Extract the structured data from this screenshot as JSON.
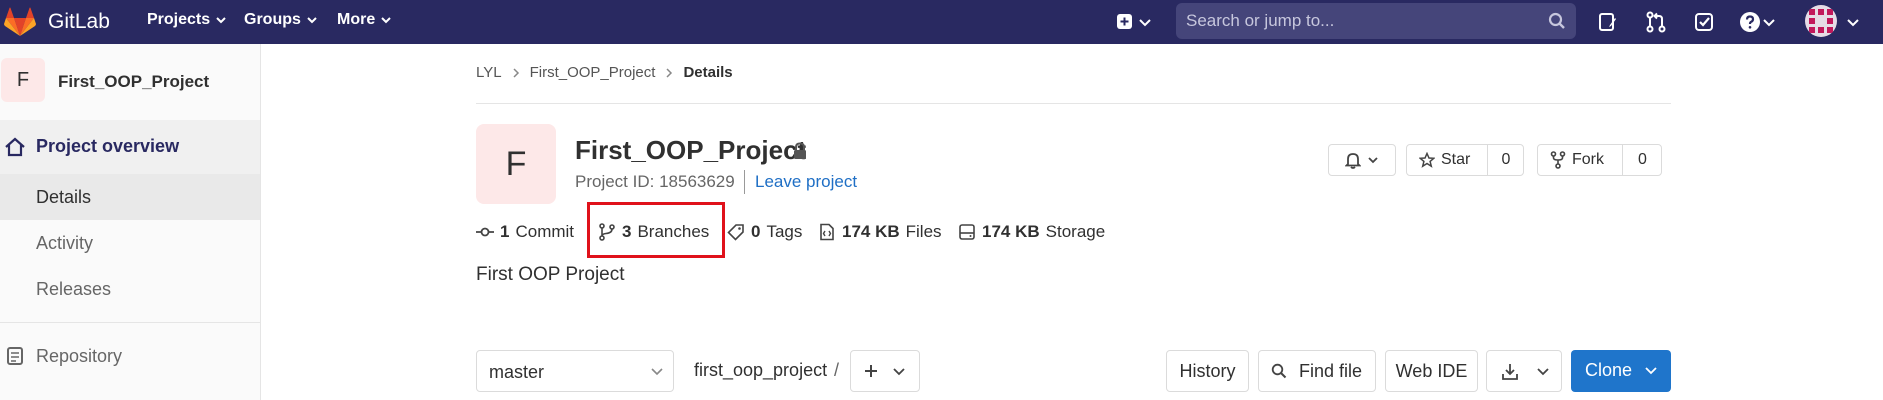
{
  "topbar": {
    "brand": "GitLab",
    "menus": [
      "Projects",
      "Groups",
      "More"
    ],
    "search_placeholder": "Search or jump to..."
  },
  "sidebar": {
    "project_initial": "F",
    "project_name": "First_OOP_Project",
    "overview_label": "Project overview",
    "items": [
      "Details",
      "Activity",
      "Releases"
    ],
    "repository_label": "Repository"
  },
  "breadcrumb": [
    "LYL",
    "First_OOP_Project",
    "Details"
  ],
  "project": {
    "initial": "F",
    "title": "First_OOP_Project",
    "id_text": "Project ID: 18563629",
    "leave_label": "Leave project",
    "star_label": "Star",
    "star_count": "0",
    "fork_label": "Fork",
    "fork_count": "0",
    "description": "First OOP Project"
  },
  "stats": {
    "commits_count": "1",
    "commits_label": "Commit",
    "branches_count": "3",
    "branches_label": "Branches",
    "tags_count": "0",
    "tags_label": "Tags",
    "files_size": "174 KB",
    "files_label": "Files",
    "storage_size": "174 KB",
    "storage_label": "Storage"
  },
  "toolbar": {
    "branch": "master",
    "path": "first_oop_project",
    "path_sep": "/",
    "history_label": "History",
    "find_file_label": "Find file",
    "web_ide_label": "Web IDE",
    "clone_label": "Clone"
  },
  "colors": {
    "nav_bg": "#292961",
    "accent_blue": "#1f75cb",
    "highlight_red": "#e0121b"
  }
}
